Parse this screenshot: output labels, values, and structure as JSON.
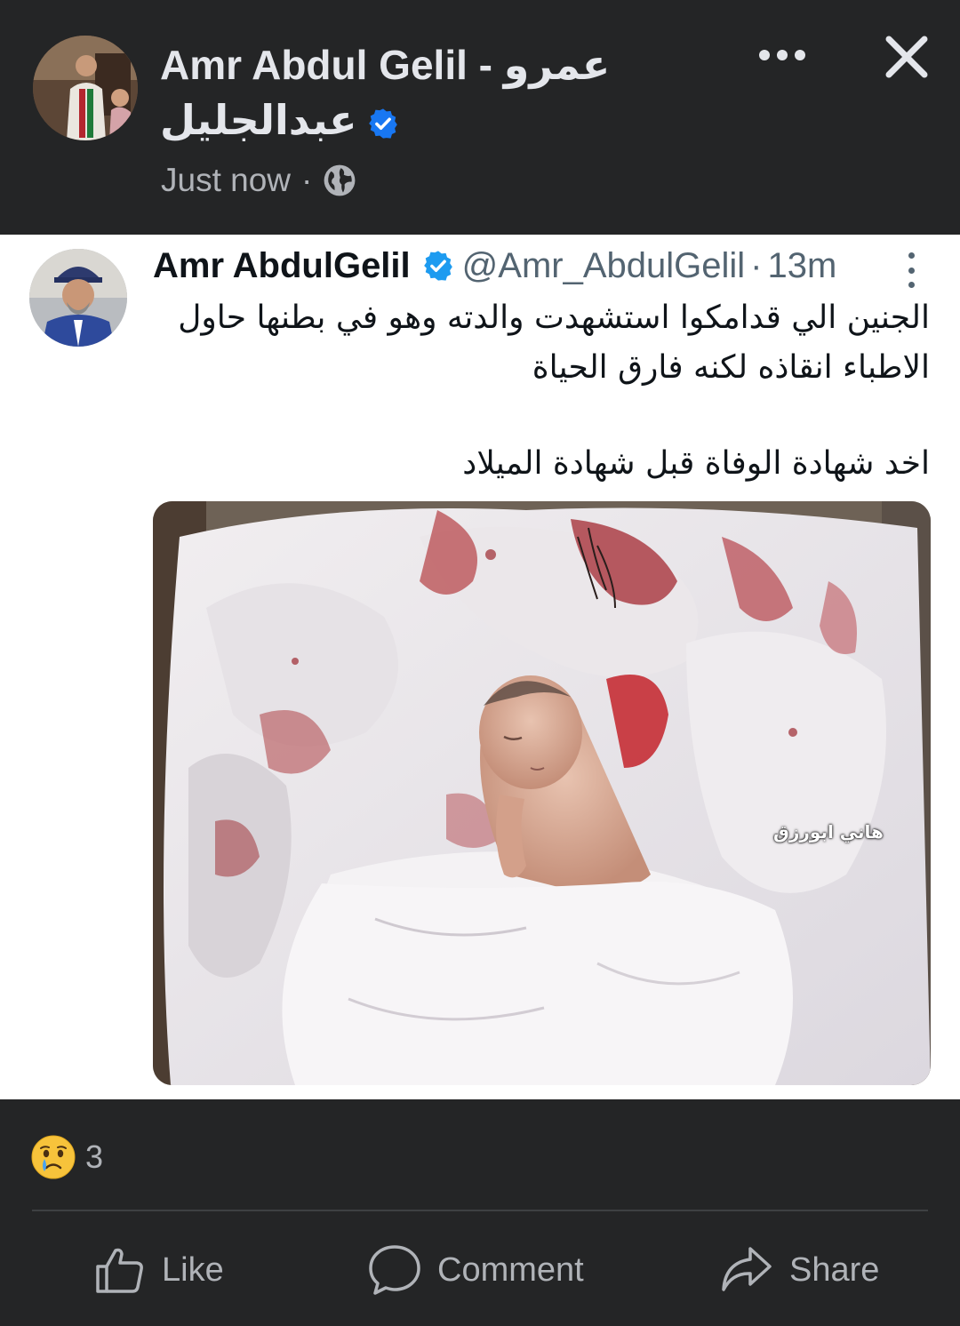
{
  "post": {
    "author_name": "Amr Abdul Gelil - عمرو",
    "author_name_line2": "عبدالجليل",
    "timestamp": "Just now",
    "separator": "·",
    "privacy_icon": "globe-icon",
    "verified_color": "#1877f2"
  },
  "tweet": {
    "name": "Amr AbdulGelil",
    "handle": "@Amr_AbdulGelil",
    "separator": "·",
    "time": "13m",
    "verified_color": "#1d9bf0",
    "text_lines": [
      "الجنين الي قدامكوا استشهدت والدته وهو في بطنها حاول",
      "الاطباء انقاذه لكنه فارق الحياة",
      "اخد شهادة الوفاة قبل شهادة الميلاد"
    ],
    "image_watermark": "هاني ابورزق"
  },
  "reactions": {
    "icon": "crying-face-icon",
    "count": "3"
  },
  "actions": {
    "like": "Like",
    "comment": "Comment",
    "share": "Share"
  },
  "colors": {
    "background": "#242526",
    "text_primary": "#e4e6eb",
    "text_secondary": "#b0b3b8",
    "tweet_background": "#ffffff"
  }
}
